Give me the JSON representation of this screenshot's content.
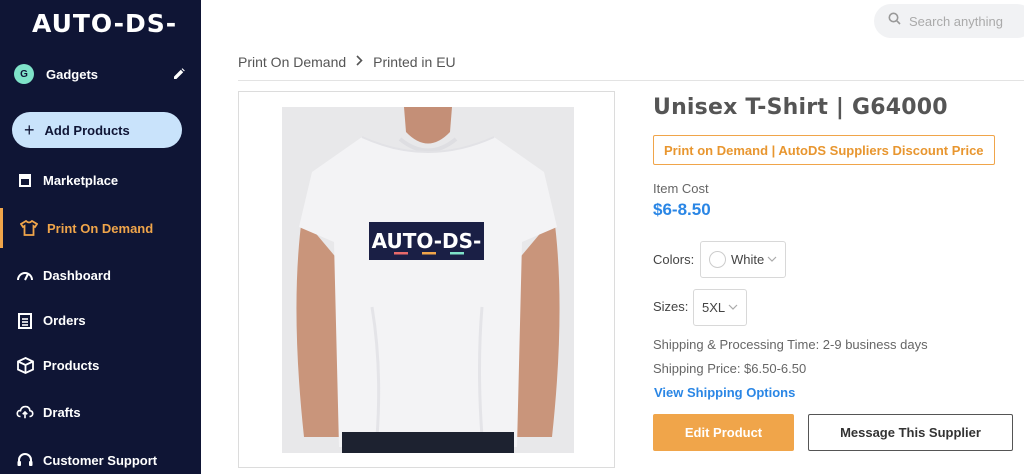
{
  "brand": {
    "logo_text": "AUTO-DS-",
    "accent": "#f0a54a",
    "sidebar_bg": "#0f1535"
  },
  "store": {
    "initial": "G",
    "name": "Gadgets"
  },
  "sidebar": {
    "add_label": "Add Products",
    "items": [
      {
        "label": "Marketplace",
        "icon": "store-icon"
      },
      {
        "label": "Print On Demand",
        "icon": "shirt-icon",
        "active": true
      },
      {
        "label": "Dashboard",
        "icon": "gauge-icon"
      },
      {
        "label": "Orders",
        "icon": "clipboard-icon"
      },
      {
        "label": "Products",
        "icon": "box-icon"
      },
      {
        "label": "Drafts",
        "icon": "cloud-upload-icon"
      },
      {
        "label": "Customer Support",
        "icon": "headset-icon"
      }
    ]
  },
  "search": {
    "placeholder": "Search anything"
  },
  "breadcrumb": [
    "Print On Demand",
    "Printed in EU"
  ],
  "product": {
    "title": "Unisex T-Shirt | G64000",
    "badge": "Print on Demand | AutoDS Suppliers Discount Price",
    "cost_label": "Item Cost",
    "cost_value": "$6-8.50",
    "image_logo_text": "AUTO-DS-",
    "colors_label": "Colors:",
    "color_value": "White",
    "sizes_label": "Sizes:",
    "size_value": "5XL",
    "shipping_time": "Shipping & Processing Time: 2-9 business days",
    "shipping_price": "Shipping Price: $6.50-6.50",
    "shipping_link": "View Shipping Options",
    "edit_label": "Edit Product",
    "message_label": "Message This Supplier"
  }
}
